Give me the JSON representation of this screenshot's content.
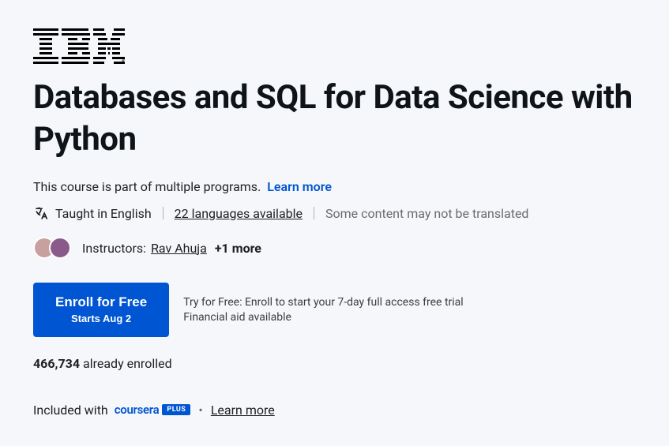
{
  "provider": "IBM",
  "course_title": "Databases and SQL for Data Science with Python",
  "program_note": "This course is part of multiple programs.",
  "learn_more_label": "Learn more",
  "language": {
    "taught_in": "Taught in English",
    "languages_available": "22 languages available",
    "not_translated_note": "Some content may not be translated"
  },
  "instructors": {
    "label": "Instructors:",
    "primary": "Rav Ahuja",
    "more": "+1 more"
  },
  "enroll": {
    "button_title": "Enroll for Free",
    "button_sub": "Starts Aug 2",
    "trial_line": "Try for Free: Enroll to start your 7-day full access free trial",
    "financial_aid": "Financial aid available"
  },
  "enrolled": {
    "count": "466,734",
    "suffix": " already enrolled"
  },
  "plus": {
    "prefix": "Included with ",
    "brand_word": "coursera",
    "badge": "PLUS",
    "dot": "•",
    "learn_more": "Learn more"
  }
}
